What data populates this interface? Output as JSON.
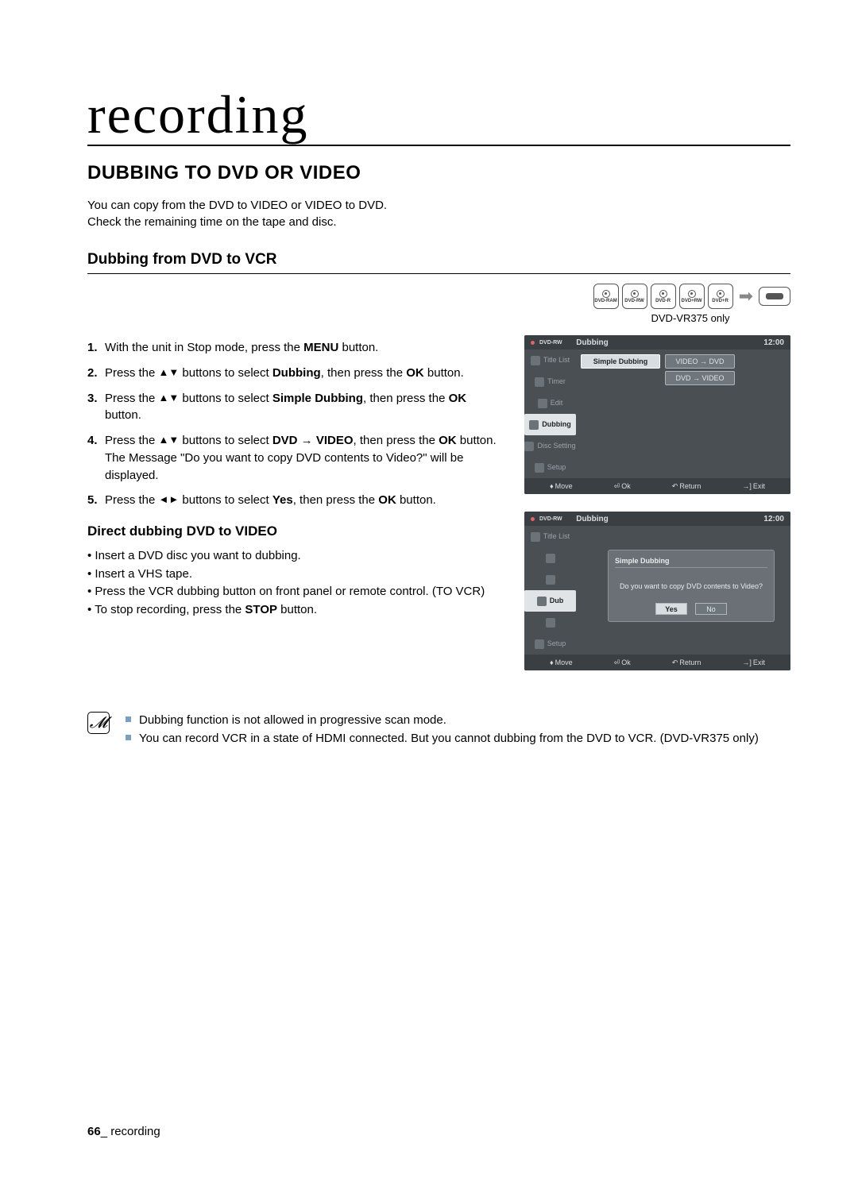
{
  "title": "recording",
  "h1": "DUBBING TO DVD OR VIDEO",
  "intro1": "You can copy from the DVD to VIDEO or VIDEO to DVD.",
  "intro2": "Check the remaining time on the tape and disc.",
  "h2": "Dubbing from DVD to VCR",
  "media_labels": [
    "DVD-RAM",
    "DVD-RW",
    "DVD-R",
    "DVD+RW",
    "DVD+R"
  ],
  "note_only": "DVD-VR375 only",
  "steps": [
    {
      "num": "1.",
      "pre": "With the unit in Stop mode, press the ",
      "b1": "MENU",
      "post1": " button."
    },
    {
      "num": "2.",
      "pre": "Press the ",
      "arr": "▲▼",
      "mid": " buttons to select ",
      "b1": "Dubbing",
      "mid2": ", then press the ",
      "b2": "OK",
      "post": " button."
    },
    {
      "num": "3.",
      "pre": "Press the ",
      "arr": "▲▼",
      "mid": " buttons to select ",
      "b1": "Simple Dubbing",
      "mid2": ", then press the ",
      "b2": "OK",
      "post": " button."
    },
    {
      "num": "4.",
      "pre": "Press the ",
      "arr": "▲▼",
      "mid": " buttons to select ",
      "b1": "DVD → VIDEO",
      "mid2": ", then press the ",
      "b2": "OK",
      "post": " button.",
      "extra": "The Message \"Do you want to copy DVD contents to Video?\" will be displayed."
    },
    {
      "num": "5.",
      "pre": "Press the ",
      "arr": "◄►",
      "mid": " buttons to select ",
      "b1": "Yes",
      "mid2": ", then press the ",
      "b2": "OK",
      "post": " button."
    }
  ],
  "h3": "Direct dubbing DVD to VIDEO",
  "bullets": [
    "Insert a DVD disc you want to dubbing.",
    "Insert a VHS tape.",
    "Press the VCR dubbing button on front panel or remote control. (TO VCR)"
  ],
  "bullet_last_pre": "To stop recording, press the ",
  "bullet_last_b": "STOP",
  "bullet_last_post": " button.",
  "notes": [
    "Dubbing function is not allowed in progressive scan mode.",
    "You can record VCR in a state of HDMI connected. But you cannot dubbing from the DVD to VCR. (DVD-VR375 only)"
  ],
  "osd": {
    "rw_label": "DVD-RW",
    "header": "Dubbing",
    "clock": "12:00",
    "side": [
      "Title List",
      "Timer",
      "Edit",
      "Dubbing",
      "Disc Setting",
      "Setup"
    ],
    "main_btn": "Simple Dubbing",
    "opt1": "VIDEO → DVD",
    "opt2": "DVD → VIDEO",
    "foot_move": "Move",
    "foot_ok": "Ok",
    "foot_return": "Return",
    "foot_exit": "Exit",
    "dialog_title": "Simple Dubbing",
    "dialog_q": "Do you want to copy DVD contents to Video?",
    "yes": "Yes",
    "no": "No"
  },
  "footer_num": "66",
  "footer_sep": "_ ",
  "footer_text": "recording"
}
